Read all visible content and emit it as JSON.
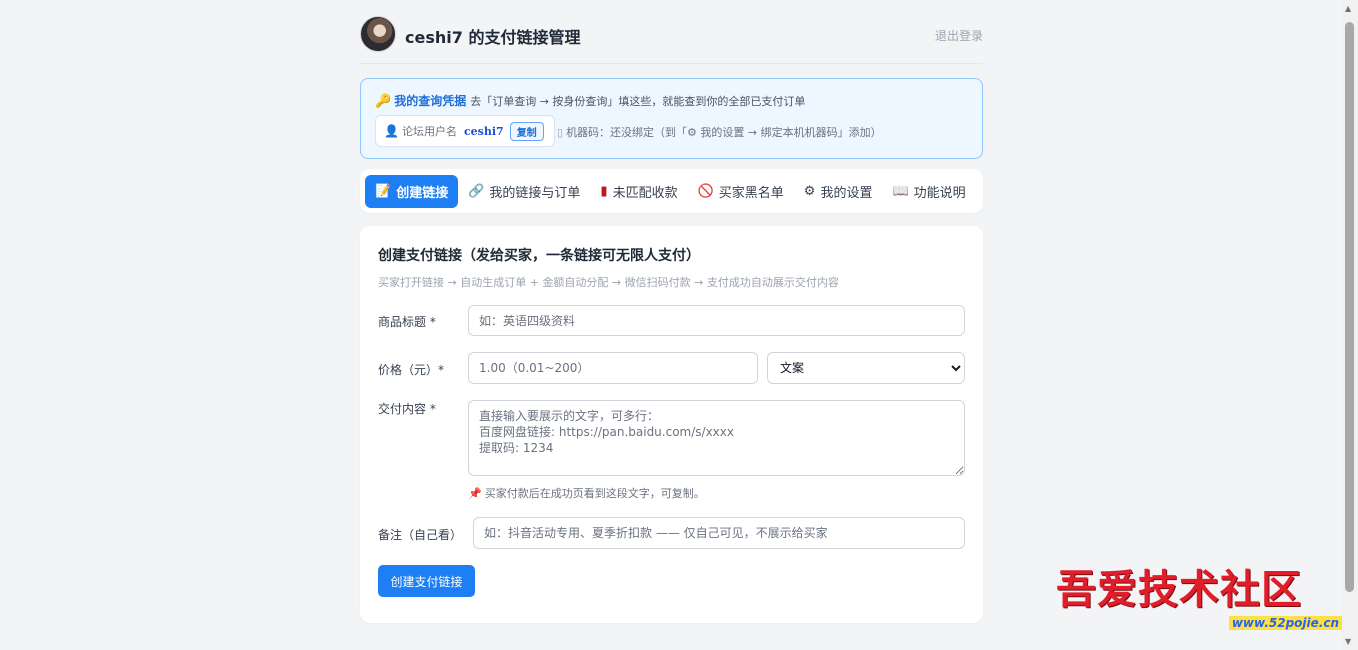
{
  "header": {
    "title": "ceshi7 的支付链接管理",
    "logout": "退出登录"
  },
  "credentials": {
    "title": "我的查询凭据",
    "desc": "去「订单查询 → 按身份查询」填这些，就能查到你的全部已支付订单",
    "username_label": "论坛用户名",
    "username": "ceshi7",
    "copy_label": "复制",
    "machine": "机器码：还没绑定（到「⚙ 我的设置 → 绑定本机机器码」添加）"
  },
  "tabs": [
    {
      "icon": "📝",
      "label": "创建链接"
    },
    {
      "icon": "🔗",
      "label": "我的链接与订单"
    },
    {
      "icon": "▮",
      "label": "未匹配收款"
    },
    {
      "icon": "🚫",
      "label": "买家黑名单"
    },
    {
      "icon": "⚙",
      "label": "我的设置"
    },
    {
      "icon": "📖",
      "label": "功能说明"
    }
  ],
  "form": {
    "title": "创建支付链接（发给买家，一条链接可无限人支付）",
    "subtitle": "买家打开链接 → 自动生成订单 + 金额自动分配 → 微信扫码付款 → 支付成功自动展示交付内容",
    "product_label": "商品标题 *",
    "product_placeholder": "如：英语四级资料",
    "price_label": "价格（元）*",
    "price_placeholder": "1.00（0.01~200）",
    "type_selected": "文案",
    "content_label": "交付内容 *",
    "content_placeholder": "直接输入要展示的文字，可多行：\n百度网盘链接: https://pan.baidu.com/s/xxxx\n提取码: 1234",
    "hint": "买家付款后在成功页看到这段文字，可复制。",
    "note_label": "备注（自己看）",
    "note_placeholder": "如：抖音活动专用、夏季折扣款 —— 仅自己可见，不展示给买家",
    "submit_label": "创建支付链接"
  },
  "watermark": {
    "title": "吾爱技术社区",
    "url": "www.52pojie.cn"
  },
  "colors": {
    "accent": "#1e7ff5",
    "cred_bg": "#eef6ff",
    "cred_border": "#93c5fd"
  }
}
